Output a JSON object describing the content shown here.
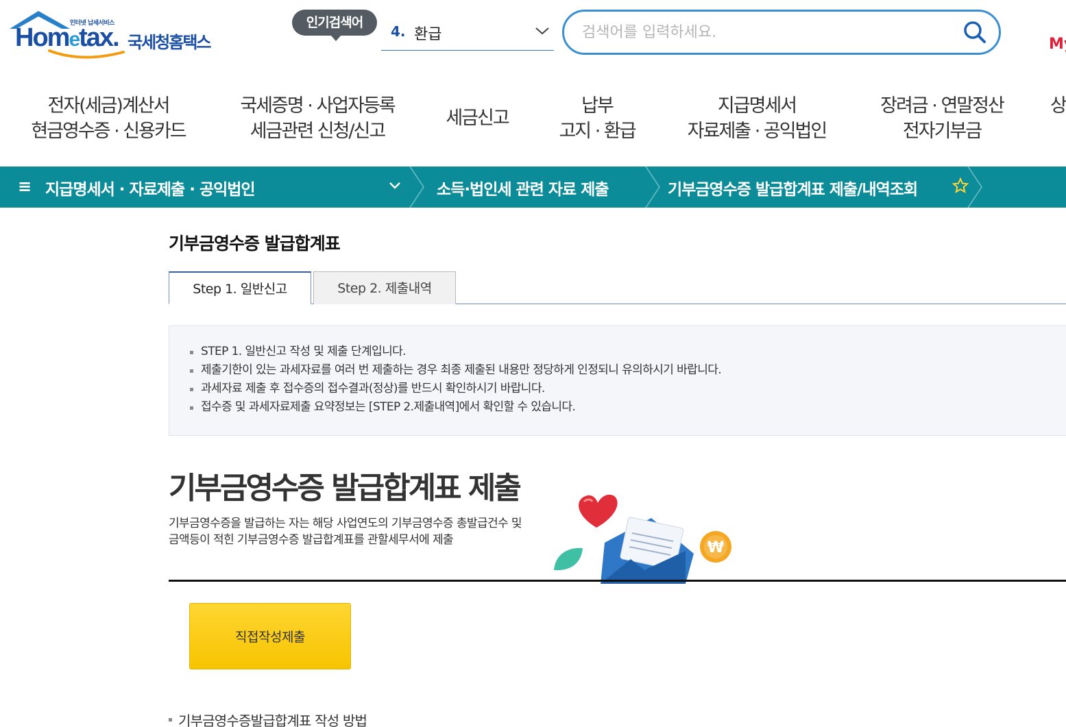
{
  "header": {
    "logo_tagline": "인터넷 납세서비스",
    "logo_main_left": "Hom",
    "logo_main_e": "e",
    "logo_main_right": "tax.",
    "logo_kr": "국세청홈택스",
    "popular_label": "인기검색어",
    "popular_rank": "4.",
    "popular_term": "환급",
    "search_placeholder": "검색어를 입력하세요.",
    "my_link": "My"
  },
  "gnb": [
    {
      "line1": "전자(세금)계산서",
      "line2": "현금영수증 · 신용카드"
    },
    {
      "line1": "국세증명 · 사업자등록",
      "line2": "세금관련 신청/신고"
    },
    {
      "line1": "세금신고",
      "line2": ""
    },
    {
      "line1": "납부",
      "line2": "고지 · 환급"
    },
    {
      "line1": "지급명세서",
      "line2": "자료제출 · 공익법인"
    },
    {
      "line1": "장려금 · 연말정산",
      "line2": "전자기부금"
    },
    {
      "line1": "상",
      "line2": ""
    }
  ],
  "location": {
    "menu": "지급명세서 · 자료제출 · 공익법인",
    "level2": "소득·법인세 관련 자료 제출",
    "level3": "기부금영수증 발급합계표 제출/내역조회"
  },
  "content": {
    "page_title": "기부금영수증 발급합계표",
    "tabs": [
      {
        "label": "Step 1. 일반신고",
        "active": true
      },
      {
        "label": "Step 2. 제출내역",
        "active": false
      }
    ],
    "info": [
      "STEP 1. 일반신고 작성 및 제출 단계입니다.",
      "제출기한이 있는 과세자료를 여러 번 제출하는 경우 최종 제출된 내용만 정당하게 인정되니 유의하시기 바랍니다.",
      "과세자료 제출 후 접수증의 접수결과(정상)를 반드시 확인하시기 바랍니다.",
      "접수증 및 과세자료제출 요약정보는 [STEP 2.제출내역]에서 확인할 수 있습니다."
    ],
    "section_title": "기부금영수증 발급합계표 제출",
    "section_desc": "기부금영수증을 발급하는 자는 해당 사업연도의 기부금영수증 총발급건수 및 금액등이 적힌 기부금영수증 발급합계표를 관할세무서에 제출",
    "submit_button": "직접작성제출",
    "howto": "기부금영수증발급합계표 작성 방법"
  },
  "colors": {
    "brand_blue": "#1a4fa3",
    "teal_bar": "#0c8c98",
    "button_yellow": "#ffcc00",
    "search_border": "#3a8fd0"
  },
  "icons": [
    "house-roof-icon",
    "chevron-down-icon",
    "search-icon",
    "hamburger-icon",
    "star-icon",
    "heart-icon",
    "envelope-icon",
    "won-coin-icon",
    "leaf-icon"
  ]
}
